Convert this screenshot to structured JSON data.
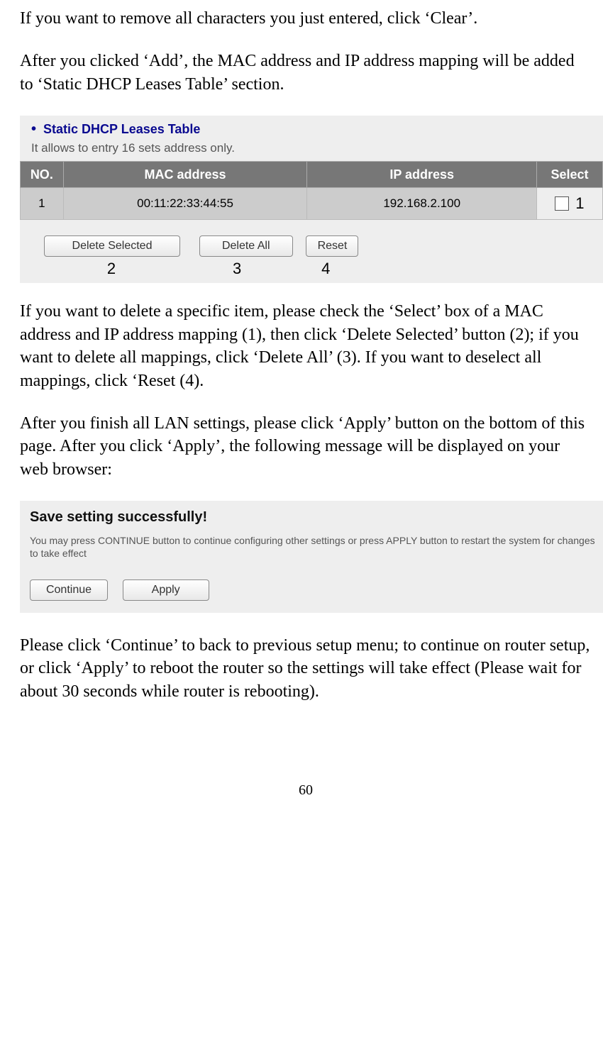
{
  "para1": "If you want to remove all characters you just entered, click ‘Clear’.",
  "para2": "After you clicked ‘Add’, the MAC address and IP address mapping will be added to ‘Static DHCP Leases Table’ section.",
  "fig1": {
    "title": "Static DHCP Leases Table",
    "subtitle": "It allows to entry 16 sets address only.",
    "headers": {
      "no": "NO.",
      "mac": "MAC address",
      "ip": "IP address",
      "select": "Select"
    },
    "rows": [
      {
        "no": "1",
        "mac": "00:11:22:33:44:55",
        "ip": "192.168.2.100"
      }
    ],
    "callout_select": "1",
    "buttons": {
      "delete_selected": "Delete Selected",
      "delete_all": "Delete All",
      "reset": "Reset"
    },
    "callouts": {
      "c2": "2",
      "c3": "3",
      "c4": "4"
    }
  },
  "para3": "If you want to delete a specific item, please check the ‘Select’ box of a MAC address and IP address mapping (1), then click ‘Delete Selected’ button (2); if you want to delete all mappings, click ‘Delete All’ (3). If you want to deselect all mappings, click ‘Reset (4).",
  "para4": "After you finish all LAN settings, please click ‘Apply’ button on the bottom of this page. After you click ‘Apply’, the following message will be displayed on your web browser:",
  "fig2": {
    "title": "Save setting successfully!",
    "message": "You may press CONTINUE button to continue configuring other settings or press APPLY button to restart the system for changes to take effect",
    "buttons": {
      "continue": "Continue",
      "apply": "Apply"
    }
  },
  "para5": "Please click ‘Continue’ to back to previous setup menu; to continue on router setup, or click ‘Apply’ to reboot the router so the settings will take effect (Please wait for about 30 seconds while router is rebooting).",
  "pagenum": "60"
}
